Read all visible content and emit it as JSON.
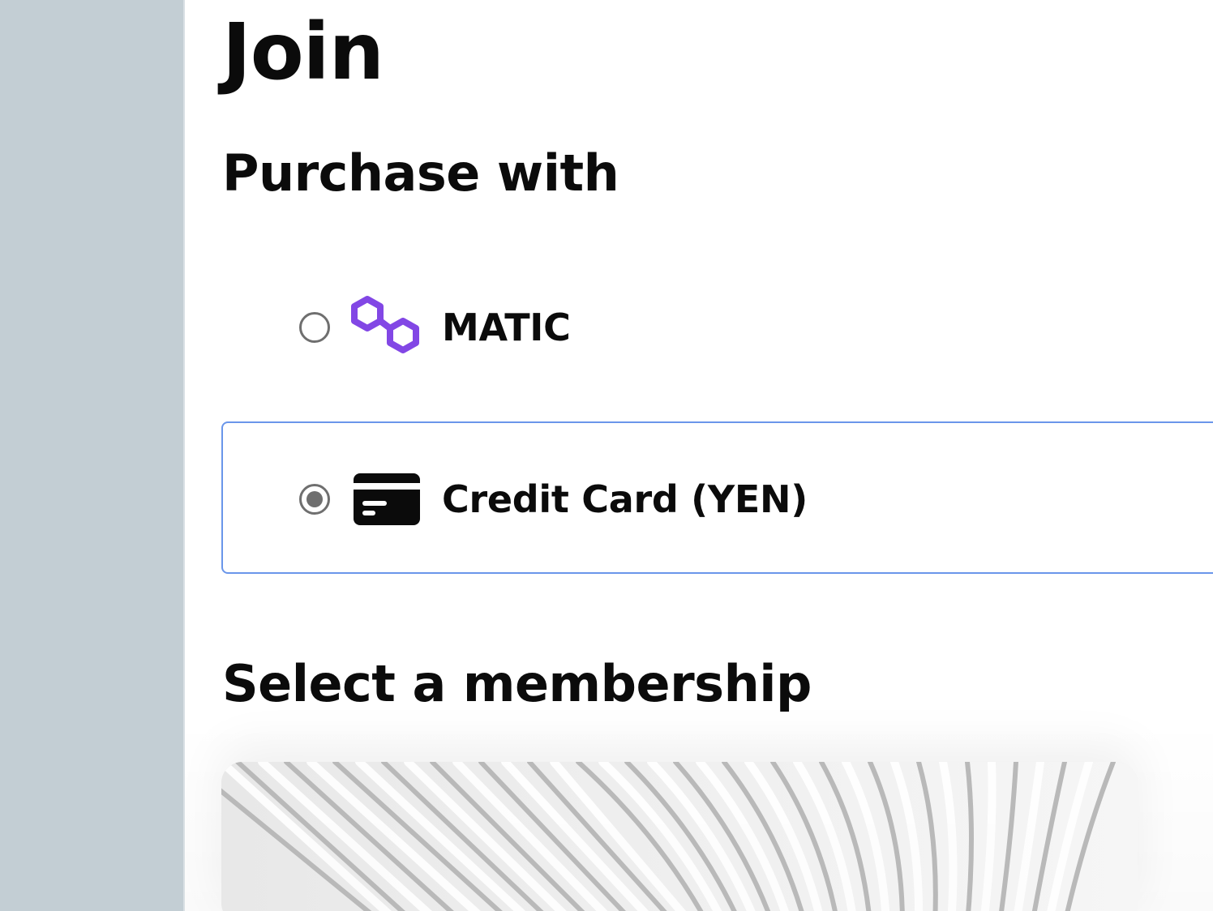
{
  "page": {
    "title": "Join"
  },
  "purchase": {
    "heading": "Purchase with",
    "options": [
      {
        "label": "MATIC",
        "icon": "polygon-matic-icon",
        "selected": false,
        "icon_color": "#8247e5"
      },
      {
        "label": "Credit Card (YEN)",
        "icon": "credit-card-icon",
        "selected": true,
        "icon_color": "#0b0b0b"
      }
    ],
    "selected_border_color": "#6a96ea"
  },
  "membership": {
    "heading": "Select a membership",
    "card_image": "abstract-white-wave-pattern"
  },
  "colors": {
    "sidebar": "#c3ced4",
    "background": "#ffffff",
    "text": "#0b0b0b"
  }
}
